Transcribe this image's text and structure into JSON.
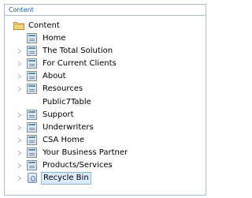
{
  "header": {
    "title": "Content"
  },
  "tree": {
    "root": {
      "label": "Content",
      "icon": "folder-icon"
    },
    "items": [
      {
        "label": "Home",
        "icon": "document-icon",
        "expandable": false
      },
      {
        "label": "The Total Solution",
        "icon": "document-icon",
        "expandable": true
      },
      {
        "label": "For Current Clients",
        "icon": "document-icon",
        "expandable": true
      },
      {
        "label": "About",
        "icon": "document-icon",
        "expandable": true
      },
      {
        "label": "Resources",
        "icon": "document-icon",
        "expandable": true
      },
      {
        "label": "Public7Table",
        "icon": "none",
        "expandable": false
      },
      {
        "label": "Support",
        "icon": "document-icon",
        "expandable": true
      },
      {
        "label": "Underwriters",
        "icon": "document-icon",
        "expandable": true
      },
      {
        "label": "CSA Home",
        "icon": "document-icon",
        "expandable": true
      },
      {
        "label": "Your Business Partner",
        "icon": "document-icon",
        "expandable": true
      },
      {
        "label": "Products/Services",
        "icon": "document-icon",
        "expandable": true
      },
      {
        "label": "Recycle Bin",
        "icon": "recycle-bin-icon",
        "expandable": true,
        "selected": true
      }
    ]
  }
}
